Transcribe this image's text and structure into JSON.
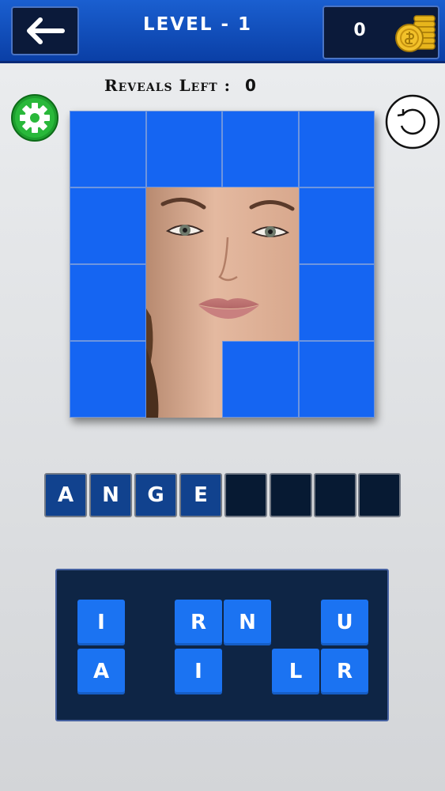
{
  "header": {
    "title": "LEVEL - 1",
    "coins": "0",
    "back_icon": "back-arrow-icon",
    "coins_icon": "gold-coins-icon"
  },
  "reveals": {
    "label": "Reveals Left :",
    "value": "0"
  },
  "puzzle": {
    "grid": "4x4",
    "hidden_tile_color": "#1565f2",
    "revealed_tiles": [
      "r2c2",
      "r2c3",
      "r3c2",
      "r3c3",
      "r4c2"
    ]
  },
  "answer": {
    "letters": [
      "A",
      "N",
      "G",
      "E",
      "",
      "",
      "",
      ""
    ]
  },
  "keyboard": {
    "row1": [
      "I",
      "",
      "R",
      "N",
      "",
      "U"
    ],
    "row2": [
      "A",
      "",
      "I",
      "",
      "L",
      "R"
    ]
  },
  "colors": {
    "header_blue": "#0a3fa6",
    "tile_blue": "#1565f2",
    "panel_navy": "#0e2545",
    "settings_green": "#1e9e2e"
  }
}
